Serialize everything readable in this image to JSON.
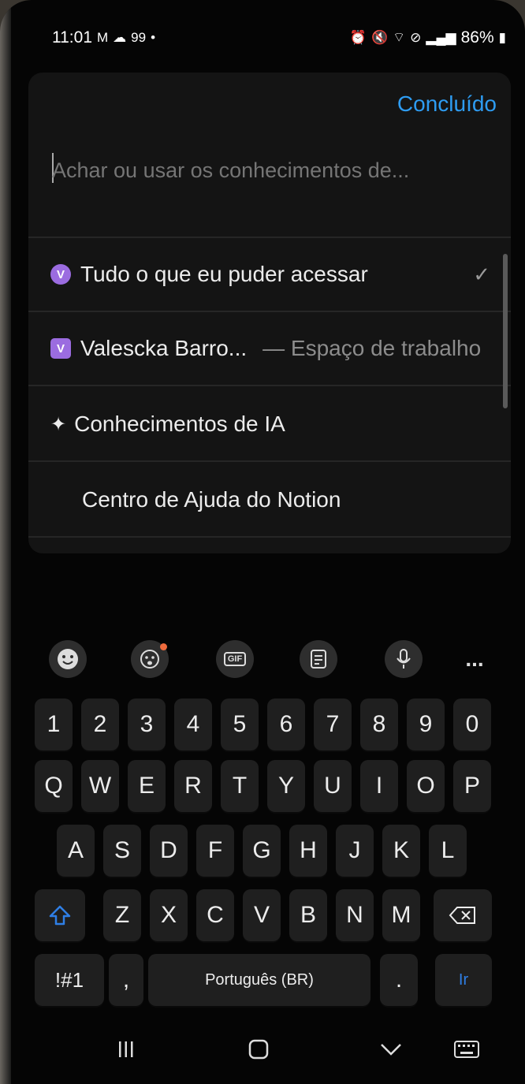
{
  "status_bar": {
    "time": "11:01",
    "left_icons": [
      "gmail-icon",
      "cloud-icon",
      "badge-99",
      "dot-icon"
    ],
    "badge_99": "99",
    "battery": "86%"
  },
  "panel": {
    "done_label": "Concluído",
    "search_placeholder": "Achar ou usar os conhecimentos de...",
    "items": [
      {
        "label": "Tudo o que eu puder acessar",
        "badge": "V",
        "checked": true
      },
      {
        "label": "Valescka Barro...",
        "badge": "V",
        "secondary": "— Espaço de trabalho"
      },
      {
        "label": "Conhecimentos de IA",
        "icon": "sparkle-icon"
      },
      {
        "label": "Centro de Ajuda do Notion"
      }
    ]
  },
  "keyboard_toolbar": {
    "icons": [
      "emoji-icon",
      "sticker-icon",
      "gif-icon",
      "clipboard-icon",
      "mic-icon",
      "more-icon"
    ],
    "gif_label": "GIF",
    "more_label": "..."
  },
  "keyboard": {
    "row_numbers": [
      "1",
      "2",
      "3",
      "4",
      "5",
      "6",
      "7",
      "8",
      "9",
      "0"
    ],
    "row_q": [
      "Q",
      "W",
      "E",
      "R",
      "T",
      "Y",
      "U",
      "I",
      "O",
      "P"
    ],
    "row_a": [
      "A",
      "S",
      "D",
      "F",
      "G",
      "H",
      "J",
      "K",
      "L"
    ],
    "row_z": [
      "Z",
      "X",
      "C",
      "V",
      "B",
      "N",
      "M"
    ],
    "symbols_label": "!#1",
    "comma_label": ",",
    "space_label": "Português (BR)",
    "period_label": ".",
    "enter_label": "Ir"
  },
  "nav_bar": {
    "icons": [
      "recents-icon",
      "home-icon",
      "back-icon",
      "keyboard-switch-icon"
    ]
  },
  "colors": {
    "accent": "#2e9cf2",
    "badge": "#9b6ce0",
    "background": "#050505"
  }
}
